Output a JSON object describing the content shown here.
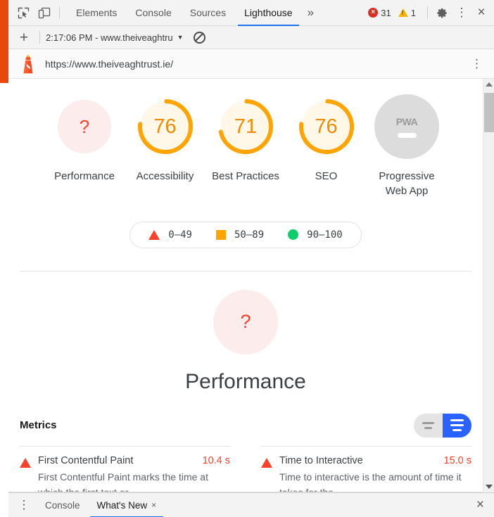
{
  "devtools": {
    "icons": {
      "inspect": "inspect-element-icon",
      "device": "device-toolbar-icon",
      "more_tabs": "»",
      "settings": "gear-icon",
      "menu": "⋮",
      "close": "×"
    },
    "tabs": [
      {
        "label": "Elements",
        "active": false
      },
      {
        "label": "Console",
        "active": false
      },
      {
        "label": "Sources",
        "active": false
      },
      {
        "label": "Lighthouse",
        "active": true
      }
    ],
    "counters": {
      "errors": "31",
      "warnings": "1",
      "error_glyph": "×",
      "warning_glyph": "!"
    }
  },
  "lighthouse_toolbar": {
    "add_label": "+",
    "report_name": "2:17:06 PM - www.theiveaghtru",
    "caret": "▼",
    "clear_icon": "no-entry-clear-icon"
  },
  "url_bar": {
    "logo": "lighthouse-logo-icon",
    "url": "https://www.theiveaghtrust.ie/",
    "menu": "⋮"
  },
  "report": {
    "gauges": [
      {
        "label": "Performance",
        "score": "?",
        "na": true,
        "ring_color": "#f9402a",
        "fill_color": "#fdecec",
        "pct": 0
      },
      {
        "label": "Accessibility",
        "score": "76",
        "na": false,
        "ring_color": "#ffa400",
        "fill_color": "#fff7e8",
        "pct": 76
      },
      {
        "label": "Best Practices",
        "score": "71",
        "na": false,
        "ring_color": "#ffa400",
        "fill_color": "#fff7e8",
        "pct": 71
      },
      {
        "label": "SEO",
        "score": "76",
        "na": false,
        "ring_color": "#ffa400",
        "fill_color": "#fff7e8",
        "pct": 76
      },
      {
        "label": "Progressive Web App",
        "score": "PWA",
        "na": false,
        "pwa": true,
        "fill_color": "#dcdcdc",
        "pct": 0
      }
    ],
    "legend": [
      {
        "shape": "triangle",
        "color": "#f9402a",
        "range": "0–49"
      },
      {
        "shape": "square",
        "color": "#ffa400",
        "range": "50–89"
      },
      {
        "shape": "circle",
        "color": "#0cce6b",
        "range": "90–100"
      }
    ],
    "performance_section": {
      "score": "?",
      "title": "Performance",
      "circle_color": "#fdecec",
      "score_color": "#f9402a"
    },
    "metrics": {
      "title": "Metrics",
      "toggle": {
        "compact_icon": "compact-view-icon",
        "expanded_icon": "expanded-view-icon",
        "active": "expanded"
      },
      "items": [
        {
          "name": "First Contentful Paint",
          "value": "10.4 s",
          "status": "fail",
          "description": "First Contentful Paint marks the time at which the first text or"
        },
        {
          "name": "Time to Interactive",
          "value": "15.0 s",
          "status": "fail",
          "description": "Time to interactive is the amount of time it takes for the"
        }
      ]
    }
  },
  "drawer": {
    "menu": "⋮",
    "tabs": [
      {
        "label": "Console",
        "active": false,
        "closable": false
      },
      {
        "label": "What's New",
        "active": true,
        "closable": true
      }
    ],
    "tab_close_glyph": "×",
    "close_glyph": "×"
  },
  "colors": {
    "accent_orange": "#e8480c",
    "brand_blue": "#1a73e8",
    "toggle_blue": "#2962ff",
    "fail_red": "#f9402a",
    "average_orange": "#ffa400",
    "pass_green": "#0cce6b",
    "error_red": "#d93025",
    "warning_yellow": "#f5b400"
  }
}
